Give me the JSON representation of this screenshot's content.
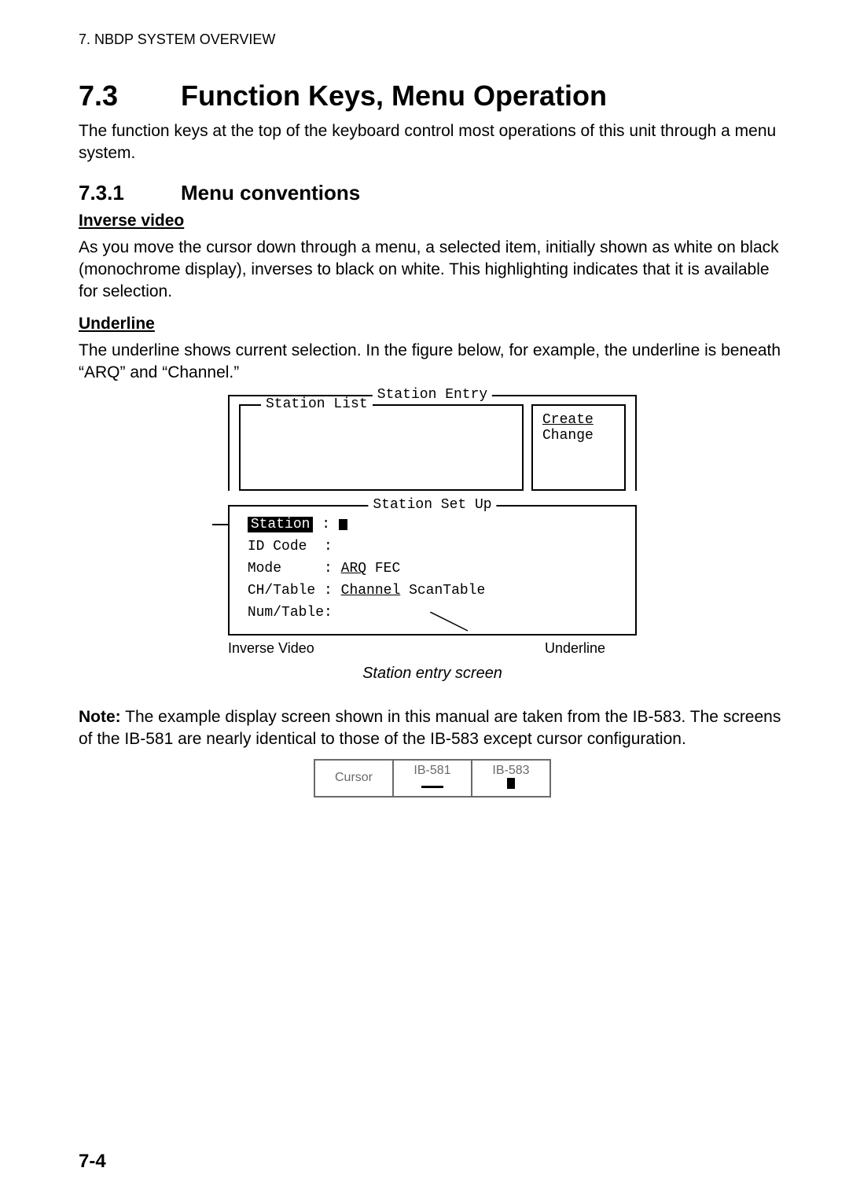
{
  "header": {
    "running_head": "7. NBDP SYSTEM OVERVIEW"
  },
  "section": {
    "number": "7.3",
    "title": "Function Keys, Menu Operation",
    "intro": "The function keys at the top of the keyboard control most operations of this unit through a menu system."
  },
  "subsection": {
    "number": "7.3.1",
    "title": "Menu conventions",
    "inverse": {
      "heading": "Inverse video",
      "text": "As you move the cursor down through a menu, a selected item, initially shown as white on black (monochrome display), inverses to black on white. This highlighting indicates that it is available for selection."
    },
    "underline": {
      "heading": "Underline",
      "text": "The underline shows current selection. In the figure below, for example, the underline is beneath “ARQ” and “Channel.”"
    }
  },
  "diagram": {
    "outer_title": "Station Entry",
    "list_title": "Station List",
    "options": {
      "create": "Create",
      "change": "Change"
    },
    "setup_title": "Station Set Up",
    "rows": {
      "station_label": "Station",
      "station_value_cursor": true,
      "id_label": "ID Code",
      "mode_label": "Mode",
      "mode_value_ul": "ARQ",
      "mode_value_rest": " FEC",
      "chtable_label": "CH/Table",
      "chtable_value_ul": "Channel",
      "chtable_value_rest": " ScanTable",
      "numtable_label": "Num/Table:"
    },
    "label_left": "Inverse Video",
    "label_right": "Underline",
    "caption": "Station entry screen"
  },
  "note": {
    "label": "Note:",
    "text": "The example display screen shown in this manual are taken from the IB-583. The screens of the IB-581 are nearly identical to those of the IB-583 except cursor configuration."
  },
  "cursor_table": {
    "c0": "Cursor",
    "c1": "IB-581",
    "c2": "IB-583"
  },
  "page_number": "7-4",
  "chart_data": {
    "type": "table",
    "title": "Cursor comparison",
    "columns": [
      "Cursor",
      "IB-581",
      "IB-583"
    ],
    "rows": [
      [
        "(shape)",
        "underline-cursor",
        "block-cursor"
      ]
    ]
  }
}
